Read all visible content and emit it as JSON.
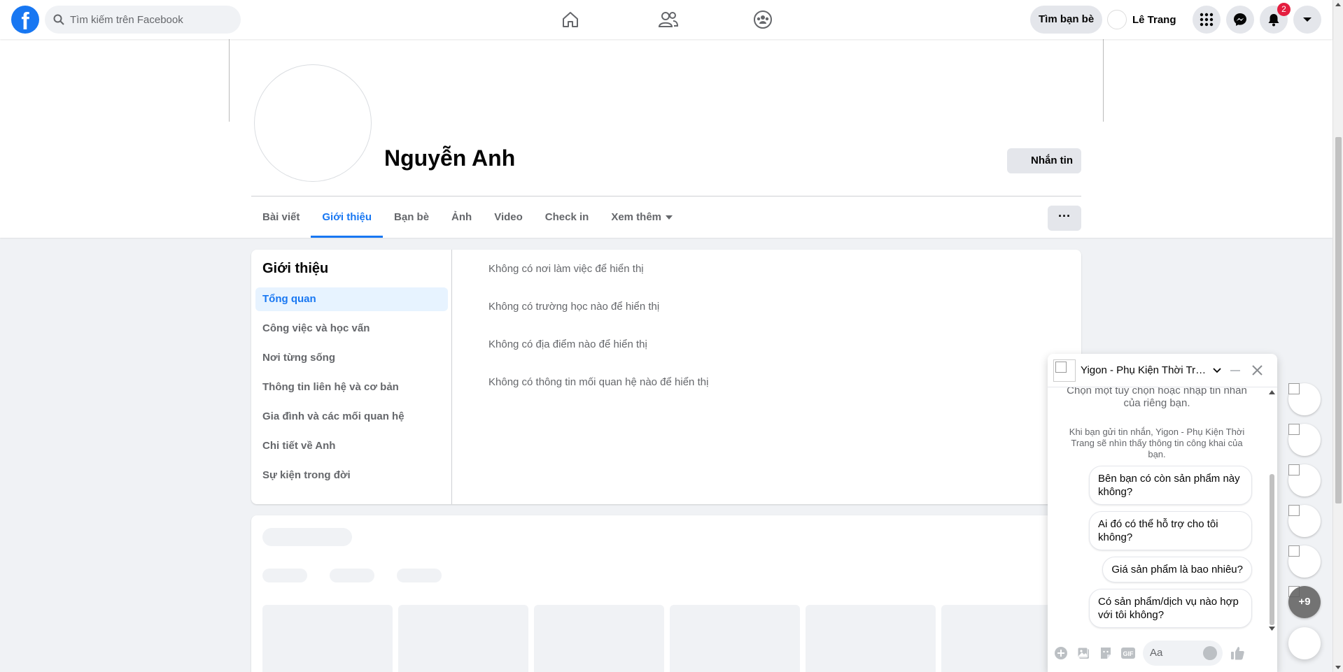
{
  "topbar": {
    "logo": "f",
    "search_placeholder": "Tìm kiếm trên Facebook",
    "find_friends": "Tìm bạn bè",
    "user_name": "Lê Trang",
    "notification_count": "2"
  },
  "profile": {
    "name": "Nguyễn Anh",
    "message_button": "Nhắn tin",
    "more_button": "···",
    "tabs": [
      "Bài viết",
      "Giới thiệu",
      "Bạn bè",
      "Ảnh",
      "Video",
      "Check in",
      "Xem thêm"
    ],
    "active_tab": "Giới thiệu"
  },
  "about": {
    "title": "Giới thiệu",
    "menu": [
      "Tổng quan",
      "Công việc và học vấn",
      "Nơi từng sống",
      "Thông tin liên hệ và cơ bản",
      "Gia đình và các mối quan hệ",
      "Chi tiết về Anh",
      "Sự kiện trong đời"
    ],
    "lines": [
      "Không có nơi làm việc để hiển thị",
      "Không có trường học nào để hiển thị",
      "Không có địa điểm nào để hiển thị",
      "Không có thông tin mối quan hệ nào để hiển thị"
    ]
  },
  "chat": {
    "title": "Yigon - Phụ Kiện Thời Trang",
    "prompt": "Chọn một tùy chọn hoặc nhập tin nhắn của riêng bạn.",
    "note": "Khi bạn gửi tin nhắn, Yigon - Phụ Kiện Thời Trang sẽ nhìn thấy thông tin công khai của bạn.",
    "quick_replies": [
      "Bên bạn có còn sản phẩm này không?",
      "Ai đó có thể hỗ trợ cho tôi không?",
      "Giá sản phẩm là bao nhiêu?",
      "Có sản phẩm/dịch vụ nào hợp với tôi không?"
    ],
    "input_placeholder": "Aa",
    "gif_label": "GIF"
  },
  "chat_heads": {
    "more_count": "+9"
  },
  "colors": {
    "accent": "#1877f2",
    "badge": "#e41e3f",
    "background": "#f0f2f5"
  }
}
